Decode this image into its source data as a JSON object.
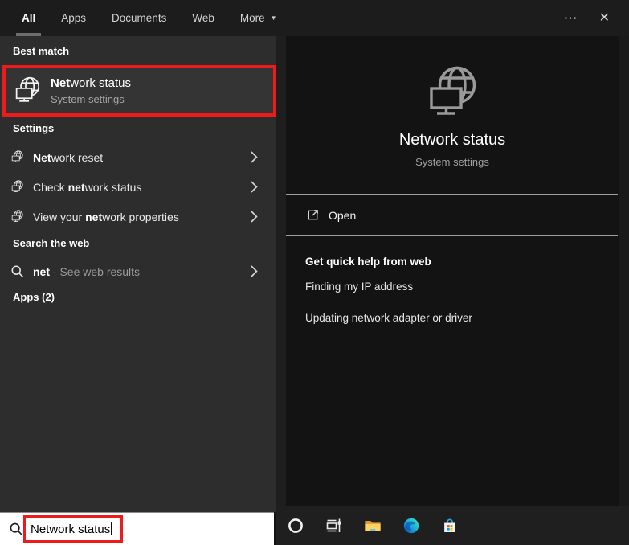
{
  "colors": {
    "accent-red": "#ed1c1c",
    "bg-topbar": "#1c1c1c",
    "bg-left": "#2d2d2d",
    "bg-card": "#343434",
    "bg-right": "#131313",
    "bg-right-strip": "#1e1e1e",
    "bg-taskbar": "#1f1f1f",
    "bg-search": "#ffffff",
    "divider": "#9e9e9e",
    "ms-red": "#f25022",
    "ms-green": "#7fba00",
    "ms-blue": "#00a4ef",
    "ms-yellow": "#ffb900"
  },
  "topbar": {
    "tabs": [
      {
        "label": "All"
      },
      {
        "label": "Apps"
      },
      {
        "label": "Documents"
      },
      {
        "label": "Web"
      },
      {
        "label": "More"
      }
    ],
    "more_arrow": "▼",
    "ellipsis": "⋯",
    "close": "✕"
  },
  "sidebar": {
    "best_match_header": "Best match",
    "best_match": {
      "title_bold": "Net",
      "title_rest": "work status",
      "subtitle": "System settings"
    },
    "settings_header": "Settings",
    "settings_items": [
      {
        "pre": "",
        "bold": "Net",
        "post": "work reset"
      },
      {
        "pre": "Check ",
        "bold": "net",
        "post": "work status"
      },
      {
        "pre": "View your ",
        "bold": "net",
        "post": "work properties"
      }
    ],
    "web_header": "Search the web",
    "web_item": {
      "bold": "net",
      "rest": " - See web results"
    },
    "apps_header": "Apps (2)"
  },
  "preview": {
    "title": "Network status",
    "subtitle": "System settings",
    "open_label": "Open",
    "help_header": "Get quick help from web",
    "help_links": [
      "Finding my IP address",
      "Updating network adapter or driver"
    ]
  },
  "search": {
    "value": "Network status"
  },
  "taskbar": {
    "icons": [
      "cortana",
      "task-view",
      "file-explorer",
      "edge",
      "store"
    ]
  }
}
